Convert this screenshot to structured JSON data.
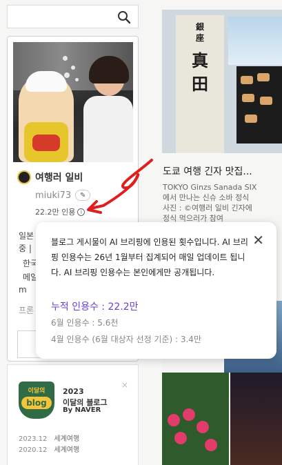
{
  "left": {
    "search_icon": "search-icon",
    "blog_name": "여행러 일비",
    "user_id": "miuki73",
    "edit_icon": "✎",
    "cite_text": "22.2만 인용",
    "info_icon": "i",
    "partial_lines": [
      "일본",
      "중 |",
      "한국",
      "메일",
      "m",
      "프론"
    ],
    "badge": {
      "top_text": "이달의",
      "logo_text": "blog",
      "year": "2023",
      "name": "이달의 블로그",
      "by": "By NAVER",
      "close": "×"
    },
    "awards": [
      {
        "date": "2023.12",
        "category": "세계여행"
      },
      {
        "date": "2020.12",
        "category": "세계여행"
      }
    ]
  },
  "right": {
    "post_title": "도쿄 여행 긴자 맛집...",
    "post_desc_lines": [
      "TOKYO Ginzs Sanada SIX",
      "에서 만나는 신슈 소바 정식",
      "사진 : ©여행러 일비 긴자에",
      "정식 먹으러가 참여"
    ],
    "image_kanji": [
      "銀",
      "座",
      "真",
      "田"
    ]
  },
  "tooltip": {
    "message": "블로그 게시물이 AI 브리핑에 인용된 횟수입니다. AI 브리핑 인용수는 26년 1월부터 집계되어 매일 업데이트 됩니다. AI 브리핑 인용수는 본인에게만 공개됩니다.",
    "close": "✕",
    "total": "누적 인용수 : 22.2만",
    "june": "6월 인용수 : 5.6천",
    "april": "4월 인용수 (6월 대상자 선정 기준) : 3.4만"
  },
  "colors": {
    "accent_purple": "#6a3fd3",
    "annotation_red": "#e01e1e",
    "badge_green": "#2f6b45",
    "badge_yellow": "#f4c43a"
  }
}
